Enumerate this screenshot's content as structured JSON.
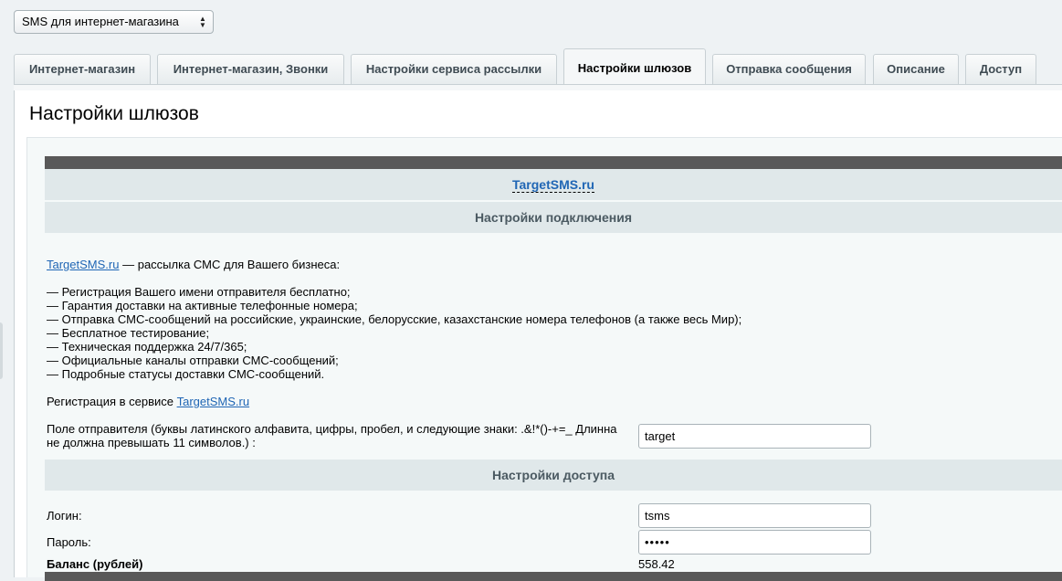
{
  "module_select": {
    "value": "SMS для интернет-магазина"
  },
  "tabs": [
    {
      "label": "Интернет-магазин"
    },
    {
      "label": "Интернет-магазин, Звонки"
    },
    {
      "label": "Настройки сервиса рассылки"
    },
    {
      "label": "Настройки шлюзов"
    },
    {
      "label": "Отправка сообщения"
    },
    {
      "label": "Описание"
    },
    {
      "label": "Доступ"
    }
  ],
  "page_title": "Настройки шлюзов",
  "gateway": {
    "name": "TargetSMS.ru",
    "connection_header": "Настройки подключения",
    "intro_link": "TargetSMS.ru",
    "intro_text": " — рассылка СМС для Вашего бизнеса:",
    "features": [
      "— Регистрация Вашего имени отправителя бесплатно;",
      "— Гарантия доставки на активные телефонные номера;",
      "— Отправка СМС-сообщений на российские, украинские, белорусские, казахстанские номера телефонов (а также весь Мир);",
      "— Бесплатное тестирование;",
      "— Техническая поддержка 24/7/365;",
      "— Официальные каналы отправки СМС-сообщений;",
      "— Подробные статусы доставки СМС-сообщений."
    ],
    "registration_text": "Регистрация в сервисе ",
    "registration_link": "TargetSMS.ru",
    "sender_label": "Поле отправителя (буквы латинского алфавита, цифры, пробел, и следующие знаки: .&!*()-+=_ Длинна не должна превышать 11 символов.) :",
    "sender_value": "target",
    "access_header": "Настройки доступа",
    "login_label": "Логин:",
    "login_value": "tsms",
    "password_label": "Пароль:",
    "password_value": "•••••",
    "balance_label": "Баланс (рублей)",
    "balance_value": "558.42"
  },
  "colors": {
    "link": "#2066b5",
    "header_bg": "#e0e8ea",
    "dark_bar": "#595959"
  }
}
